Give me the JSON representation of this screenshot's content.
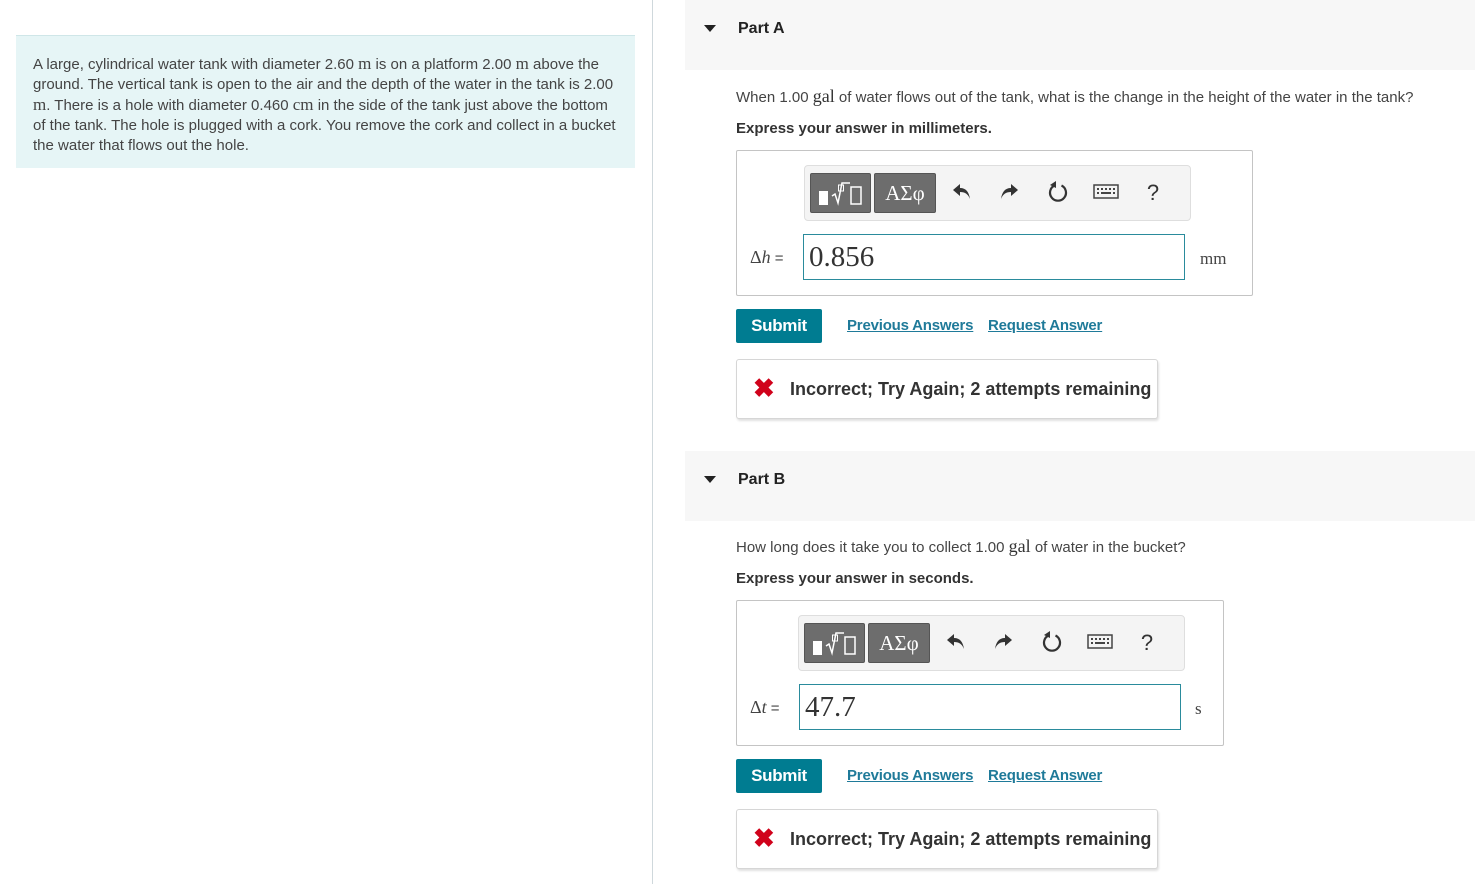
{
  "problem": {
    "segments": [
      {
        "t": "A large, cylindrical water tank with diameter 2.60 "
      },
      {
        "t": "m",
        "mu": true
      },
      {
        "t": " is on a platform 2.00 "
      },
      {
        "t": "m",
        "mu": true
      },
      {
        "t": " above the ground. The vertical tank is open to the air and the depth of the water in the tank is 2.00 "
      },
      {
        "t": "m",
        "mu": true
      },
      {
        "t": ". There is a hole with diameter 0.460 "
      },
      {
        "t": "cm",
        "mu": true
      },
      {
        "t": " in the side of the tank just above the bottom of the tank. The hole is plugged with a cork. You remove the cork and collect in a bucket the water that flows out the hole."
      }
    ]
  },
  "parts": [
    {
      "title": "Part A",
      "question_pre": "When 1.00 ",
      "question_unit": "gal",
      "question_post": " of water flows out of the tank, what is the change in the height of the water in the tank?",
      "express": "Express your answer in millimeters.",
      "var_delta": "Δ",
      "var_symbol": "h",
      "var_eq": " =",
      "value": "0.856",
      "unit": "mm",
      "toolbar": {
        "greek_label": "ΑΣφ",
        "help_label": "?"
      },
      "submit_label": "Submit",
      "previous_answers_label": "Previous Answers",
      "request_answer_label": "Request Answer",
      "feedback": "Incorrect; Try Again; 2 attempts remaining"
    },
    {
      "title": "Part B",
      "question_pre": "How long does it take you to collect 1.00 ",
      "question_unit": "gal",
      "question_post": " of water in the bucket?",
      "express": "Express your answer in seconds.",
      "var_delta": "Δ",
      "var_symbol": "t",
      "var_eq": " =",
      "value": "47.7",
      "unit": "s",
      "toolbar": {
        "greek_label": "ΑΣφ",
        "help_label": "?"
      },
      "submit_label": "Submit",
      "previous_answers_label": "Previous Answers",
      "request_answer_label": "Request Answer",
      "feedback": "Incorrect; Try Again; 2 attempts remaining"
    }
  ],
  "colors": {
    "accent": "#007c91",
    "link": "#1f7a99",
    "error": "#d0021b",
    "problem_bg": "#e6f5f6"
  }
}
